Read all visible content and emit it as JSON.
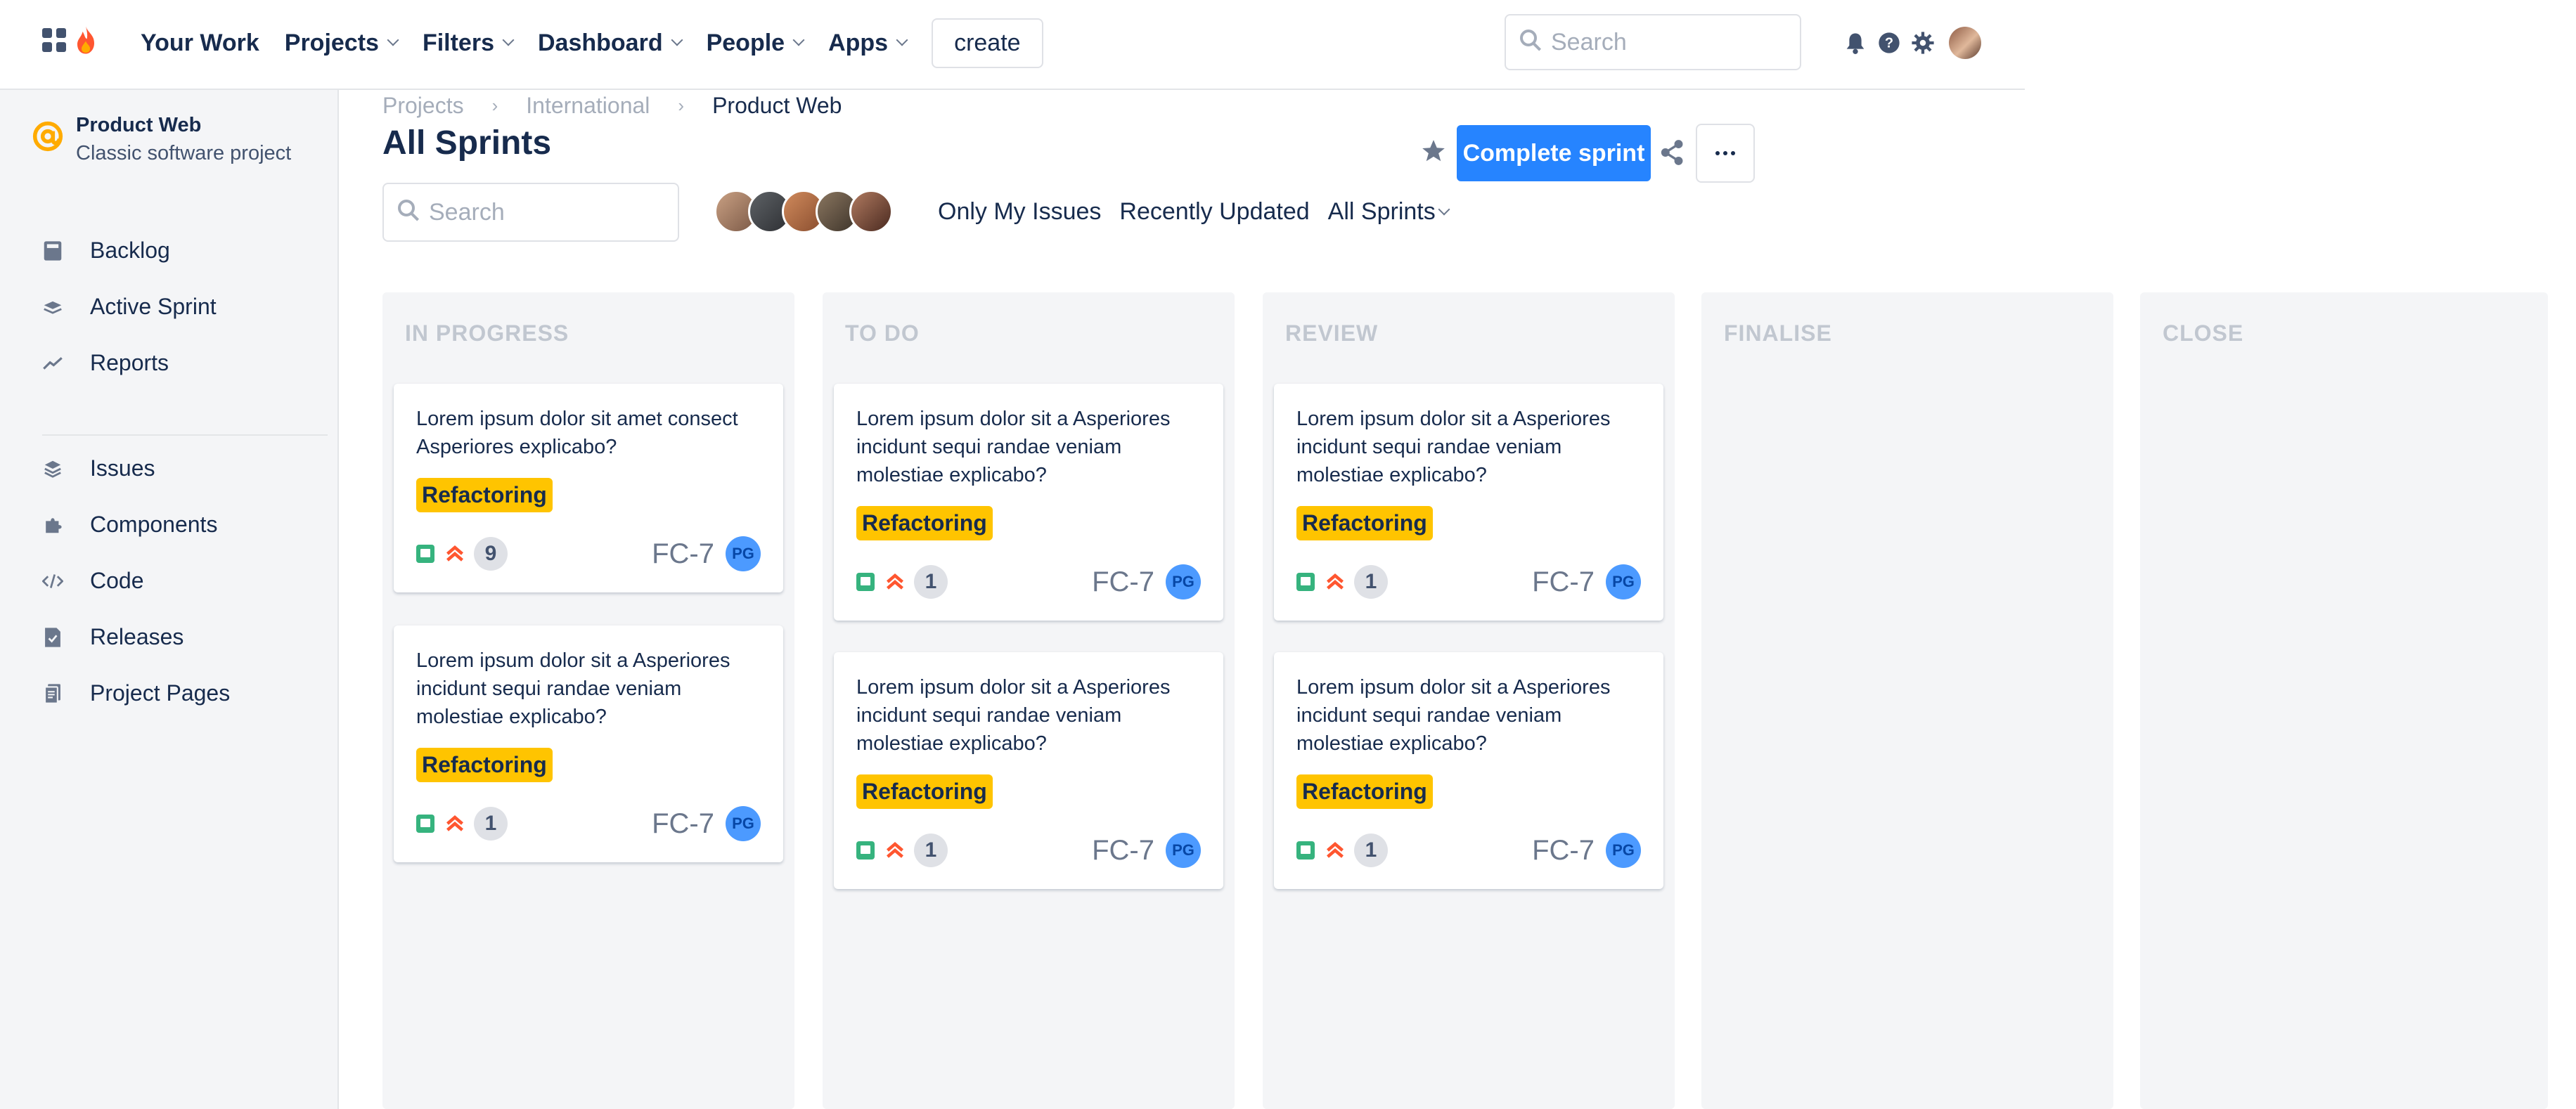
{
  "topbar": {
    "nav": [
      {
        "label": "Your Work",
        "dropdown": false
      },
      {
        "label": "Projects",
        "dropdown": true
      },
      {
        "label": "Filters",
        "dropdown": true
      },
      {
        "label": "Dashboard",
        "dropdown": true
      },
      {
        "label": "People",
        "dropdown": true
      },
      {
        "label": "Apps",
        "dropdown": true
      }
    ],
    "create_label": "create",
    "search_placeholder": "Search",
    "icons": [
      "notification-bell-icon",
      "help-icon",
      "settings-gear-icon",
      "user-avatar"
    ]
  },
  "sidebar": {
    "project_name": "Product Web",
    "project_type": "Classic software project",
    "items": [
      {
        "label": "Backlog",
        "icon": "backlog-icon"
      },
      {
        "label": "Active Sprint",
        "icon": "active-sprint-icon"
      },
      {
        "label": "Reports",
        "icon": "reports-chart-icon"
      },
      {
        "label": "Issues",
        "icon": "issues-layers-icon"
      },
      {
        "label": "Components",
        "icon": "components-puzzle-icon"
      },
      {
        "label": "Code",
        "icon": "code-icon"
      },
      {
        "label": "Releases",
        "icon": "releases-icon"
      },
      {
        "label": "Project Pages",
        "icon": "project-pages-icon"
      }
    ]
  },
  "header": {
    "breadcrumb": [
      "Projects",
      "International",
      "Product Web"
    ],
    "title": "All Sprints",
    "complete_sprint_label": "Complete sprint"
  },
  "board": {
    "search_placeholder": "Search",
    "filters": {
      "only_mine": "Only My Issues",
      "recent": "Recently Updated",
      "sprints": "All Sprints"
    },
    "columns": [
      {
        "title": "IN PROGRESS",
        "cards": [
          {
            "text": "Lorem ipsum dolor sit amet consect Asperiores explicabo?",
            "tag": "Refactoring",
            "count": "9",
            "key": "FC-7",
            "assignee": "PG"
          },
          {
            "text": "Lorem ipsum dolor sit a Asperiores incidunt sequi randae veniam molestiae explicabo?",
            "tag": "Refactoring",
            "count": "1",
            "key": "FC-7",
            "assignee": "PG"
          }
        ]
      },
      {
        "title": "TO DO",
        "cards": [
          {
            "text": "Lorem ipsum dolor sit a Asperiores incidunt sequi randae veniam molestiae explicabo?",
            "tag": "Refactoring",
            "count": "1",
            "key": "FC-7",
            "assignee": "PG"
          },
          {
            "text": "Lorem ipsum dolor sit a Asperiores incidunt sequi randae veniam molestiae explicabo?",
            "tag": "Refactoring",
            "count": "1",
            "key": "FC-7",
            "assignee": "PG"
          }
        ]
      },
      {
        "title": "REVIEW",
        "cards": [
          {
            "text": "Lorem ipsum dolor sit a Asperiores incidunt sequi randae veniam molestiae explicabo?",
            "tag": "Refactoring",
            "count": "1",
            "key": "FC-7",
            "assignee": "PG"
          },
          {
            "text": "Lorem ipsum dolor sit a Asperiores incidunt sequi randae veniam molestiae explicabo?",
            "tag": "Refactoring",
            "count": "1",
            "key": "FC-7",
            "assignee": "PG"
          }
        ]
      },
      {
        "title": "FINALISE",
        "cards": []
      },
      {
        "title": "CLOSE",
        "cards": []
      }
    ]
  },
  "colors": {
    "primary": "#2684ff",
    "tag": "#ffc400",
    "story": "#36b37e",
    "priority": "#ff5630",
    "column_bg": "#f4f5f7"
  }
}
